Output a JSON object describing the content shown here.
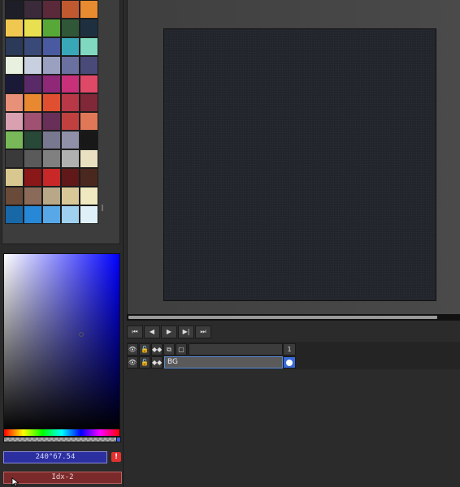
{
  "palette": {
    "swatches": [
      "#1e1e28",
      "#3a2a3a",
      "#5a2a3a",
      "#c05830",
      "#e88a30",
      "#f0c850",
      "#e8e050",
      "#58a838",
      "#305838",
      "#1e3040",
      "#2a3a58",
      "#3a4a78",
      "#4a5aa0",
      "#38a8b8",
      "#80d8c0",
      "#e8f0e0",
      "#c8d0e0",
      "#9aa0c0",
      "#6a70a0",
      "#4a4a78",
      "#1a1a38",
      "#5a2a68",
      "#902878",
      "#c8307a",
      "#e04868",
      "#e89078",
      "#e88830",
      "#e05030",
      "#b83848",
      "#802838",
      "#d8a0b0",
      "#a05070",
      "#683058",
      "#c04040",
      "#e07858",
      "#78b858",
      "#284838",
      "#787890",
      "#9090a8",
      "#181818",
      "#3a3a3a",
      "#5a5a5a",
      "#808080",
      "#b0b0b0",
      "#e8e0c0",
      "#d8c890",
      "#8a1818",
      "#c82828",
      "#601818",
      "#4a2820",
      "#6a4a38",
      "#8a6a58",
      "#b8a888",
      "#d8c898",
      "#f0e8c0",
      "#1868a8",
      "#2888d8",
      "#58a8e8",
      "#a0d0f0",
      "#e0f0f8"
    ]
  },
  "color_picker": {
    "hsv_value": "240°67.54",
    "index_value": "Idx-2",
    "warn_glyph": "!"
  },
  "timeline": {
    "transport": [
      "⏮",
      "◀",
      "▶",
      "▶|",
      "⏭"
    ],
    "header_frame": "1",
    "layers": [
      {
        "name": "BG"
      }
    ]
  }
}
